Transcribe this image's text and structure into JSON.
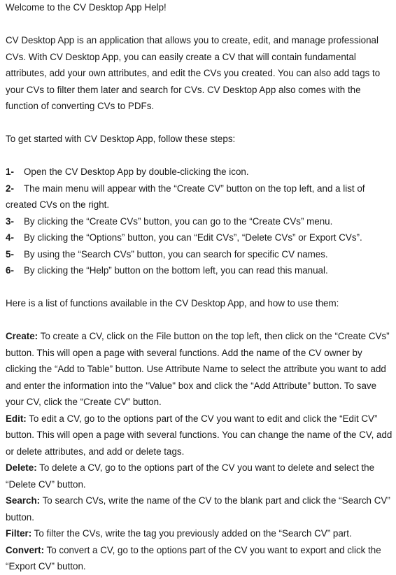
{
  "title": "Welcome to the CV Desktop App Help!",
  "intro": "CV Desktop App is an application that allows you to create, edit, and manage professional CVs. With CV Desktop App, you can easily create a CV that will contain fundamental attributes, add your own attributes, and edit the CVs you created. You can also add tags to your CVs to filter them later and search for CVs. CV Desktop App also comes with the function of converting CVs to PDFs.",
  "steps_intro": "To get started with CV Desktop App, follow these steps:",
  "steps": [
    {
      "num": "1-",
      "text": "Open the CV Desktop App by double-clicking the icon."
    },
    {
      "num": "2-",
      "text": "The main menu will appear with the “Create CV” button on the top left, and a list of created CVs on the right."
    },
    {
      "num": "3-",
      "text": "By clicking the “Create CVs” button, you can go to the “Create CVs” menu."
    },
    {
      "num": "4-",
      "text": "By clicking the “Options” button, you can “Edit CVs”, “Delete CVs” or Export CVs”."
    },
    {
      "num": "5-",
      "text": "By using the “Search CVs” button, you can search for specific CV names."
    },
    {
      "num": "6-",
      "text": "By clicking the “Help” button on the bottom left, you can read this manual."
    }
  ],
  "functions_intro": "Here is a list of functions available in the CV Desktop App, and how to use them:",
  "functions": [
    {
      "term": "Create:",
      "text": " To create a CV, click on the File button on the top left, then click on the “Create CVs” button. This will open a page with several functions. Add the name of the CV owner by clicking the “Add to Table” button. Use Attribute Name to select the attribute you want to add and enter the information into the \"Value\" box and click the “Add Attribute” button. To save your CV, click the “Create CV” button."
    },
    {
      "term": "Edit:",
      "text": " To edit a CV, go to the options part of the CV you want to edit and click the “Edit CV” button. This will open a page with several functions. You can change the name of the CV, add or delete attributes, and add or delete tags."
    },
    {
      "term": "Delete:",
      "text": " To delete a CV, go to the options part of the CV you want to delete and select the “Delete CV” button."
    },
    {
      "term": "Search:",
      "text": " To search CVs, write the name of the CV to the blank part and click the “Search CV” button."
    },
    {
      "term": "Filter:",
      "text": " To filter the CVs, write the tag you previously added on the “Search CV” part."
    },
    {
      "term": "Convert:",
      "text": " To convert a CV, go to the options part of the CV you want to export and click the “Export CV” button."
    }
  ]
}
